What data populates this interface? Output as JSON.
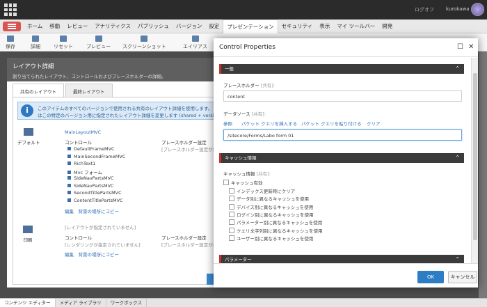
{
  "header": {
    "logout": "ログオフ",
    "username": "kurokawa"
  },
  "ribbon_tabs": [
    "ホーム",
    "移動",
    "レビュー",
    "アナリティクス",
    "パブリッシュ",
    "バージョン",
    "設定",
    "プレゼンテーション",
    "セキュリティ",
    "表示",
    "マイ ツールバー",
    "開発"
  ],
  "ribbon_active": "プレゼンテーション",
  "toolbar": [
    "保存",
    "詳細",
    "リセット",
    "プレビュー",
    "スクリーンショット",
    "エイリアス"
  ],
  "layout_panel": {
    "title": "レイアウト詳細",
    "subtitle": "割り当てられたレイアウト、コントロールおよびプレースホルダーの詳細。",
    "tabs": [
      "共有のレイアウト",
      "最終レイアウト"
    ],
    "info": [
      "このアイテムのすべてのバージョンで使用される共有のレイアウト詳細を使用します。",
      "はこの特定のバージョン用に指定されたレイアウト詳細を変更します (shared + versioned de"
    ],
    "device_default": "デフォルト",
    "layout_name": "MainLayoutMVC",
    "controls_label": "コントロール",
    "placeholder_label": "プレースホルダー設定",
    "placeholder_note": "[プレースホルダー設定が指定さ",
    "controls": [
      "DefaultFrameMVC",
      "MainSecondFrameMVC",
      "RichText1",
      "Mvc フォーム",
      "SideNavPartsMVC",
      "SideNavPartsMVC",
      "SecondTitlePartsMVC",
      "ContentTitlePartsMVC"
    ],
    "edit_links": "編集　背景の場所にコピー",
    "device_print": "印刷",
    "no_layout": "[レイアウトが指定されていません]",
    "no_rendering": "[レンダリングが指定されていません]"
  },
  "modal": {
    "title": "Control Properties",
    "section_general": "一般",
    "placeholder_label": "プレースホルダー",
    "shared_tag": "[共有]:",
    "placeholder_value": "content",
    "datasource_label": "データソース",
    "datasource_links": [
      "参照",
      "パケット クエリを挿入する",
      "パケット クエリを貼り付ける",
      "クリア"
    ],
    "datasource_value": "/sitecore/Forms/Labo form 01",
    "section_cache": "キャッシュ情報",
    "cache_label": "キャッシュ情報",
    "cache_enabled": "キャッシュ有効",
    "cache_options": [
      "インデックス更新時にクリア",
      "データ別に異なるキャッシュを使用",
      "デバイス別に異なるキャッシュを使用",
      "ログイン別に異なるキャッシュを使用",
      "パラメーター別に異なるキャッシュを使用",
      "クエリ文字列別に異なるキャッシュを使用",
      "ユーザー別に異なるキャッシュを使用"
    ],
    "section_params": "パラメーター",
    "ok": "OK",
    "cancel": "キャンセル"
  },
  "bottom_tabs": [
    "コンテンツ エディター",
    "メディア ライブラリ",
    "ワークボックス"
  ]
}
